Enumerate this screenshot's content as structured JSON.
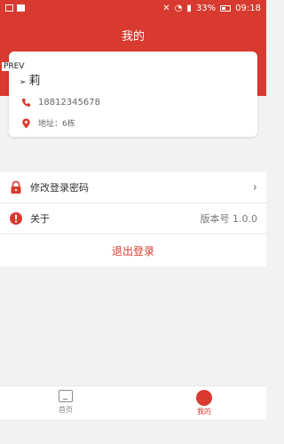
{
  "status_bar": {
    "battery": "33%",
    "time": "09:18"
  },
  "header": {
    "title": "我的"
  },
  "profile": {
    "prev_label": "PREV",
    "name": "莉",
    "phone": "18812345678",
    "address": "地址：6栋"
  },
  "menu": {
    "change_password": "修改登录密码",
    "about": "关于",
    "version": "版本号 1.0.0",
    "logout": "退出登录"
  },
  "tabs": [
    {
      "label": "首页"
    },
    {
      "label": "我的"
    }
  ],
  "colors": {
    "accent": "#d83a2f"
  },
  "icons": [
    "phone-icon",
    "location-pin-icon",
    "lock-icon",
    "info-icon",
    "chevron-right-icon",
    "home-icon",
    "profile-icon"
  ]
}
